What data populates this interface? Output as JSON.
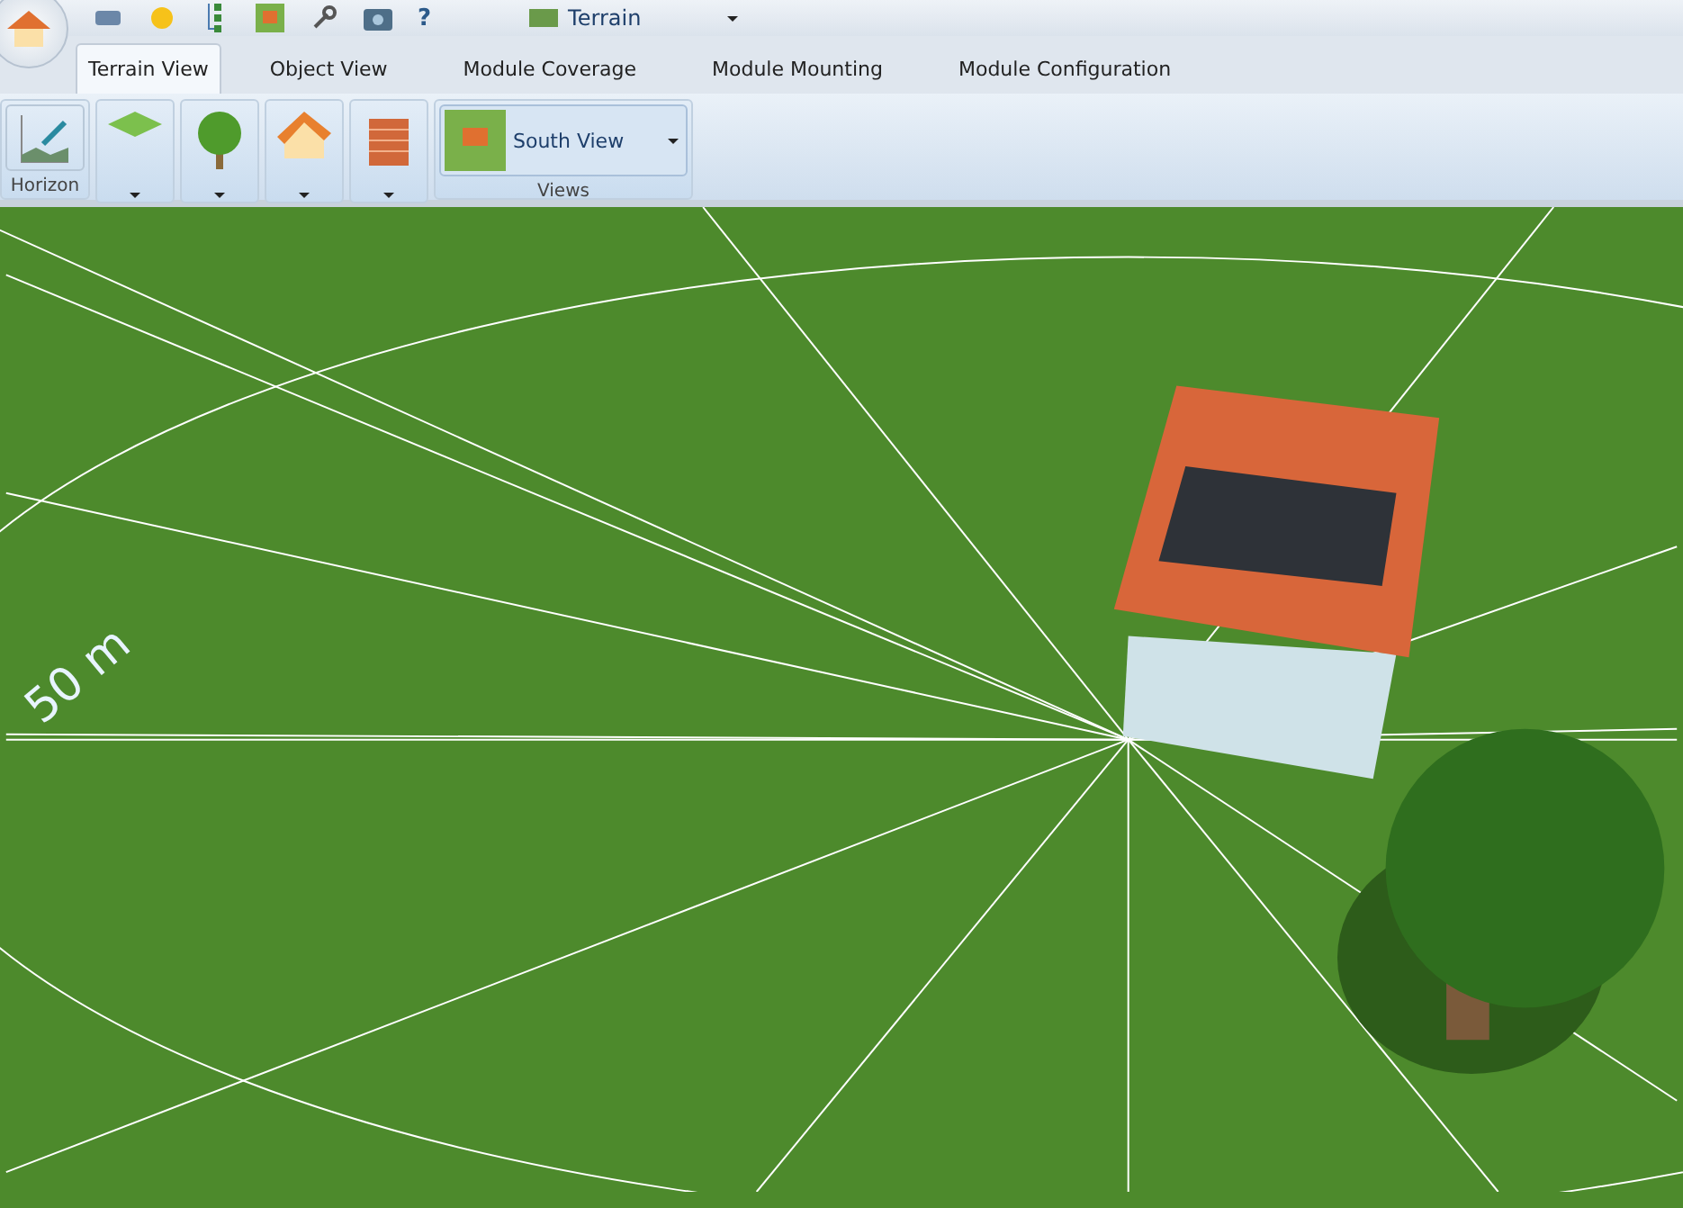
{
  "quick_access": {
    "terrain_select": {
      "value": "Terrain"
    },
    "help": "?"
  },
  "tabs": [
    {
      "label": "Terrain View",
      "selected": true
    },
    {
      "label": "Object View",
      "selected": false
    },
    {
      "label": "Module Coverage",
      "selected": false
    },
    {
      "label": "Module Mounting",
      "selected": false
    },
    {
      "label": "Module Configuration",
      "selected": false
    }
  ],
  "ribbon": {
    "horizon_group": {
      "label": "Horizon"
    },
    "object_buttons": [
      {
        "kind": "ground"
      },
      {
        "kind": "tree"
      },
      {
        "kind": "house"
      },
      {
        "kind": "wall"
      }
    ],
    "views_group": {
      "label": "Views",
      "select": {
        "value": "South View"
      }
    }
  },
  "scene": {
    "distance_label": "50 m"
  }
}
